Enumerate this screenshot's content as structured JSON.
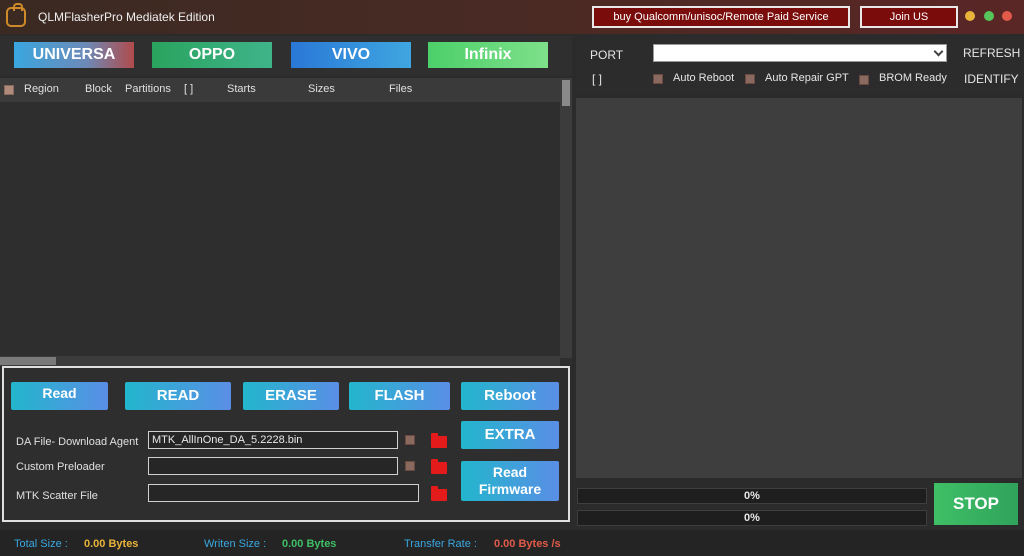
{
  "window": {
    "title": "QLMFlasherPro Mediatek Edition",
    "paid_service_label": "buy Qualcomm/unisoc/Remote Paid Service",
    "join_label": "Join US"
  },
  "brands": {
    "universa": "UNIVERSA",
    "oppo": "OPPO",
    "vivo": "VIVO",
    "infinix": "Infinix"
  },
  "partition_table": {
    "columns": [
      "Region",
      "Block",
      "Partitions",
      "[ ]",
      "Starts",
      "Sizes",
      "Files"
    ]
  },
  "operations": {
    "read_small": "Read",
    "read": "READ",
    "erase": "ERASE",
    "flash": "FLASH",
    "reboot": "Reboot",
    "extra": "EXTRA",
    "read_firmware": "Read Firmware"
  },
  "files": {
    "da_label": "DA File- Download Agent",
    "da_value": "MTK_AllInOne_DA_5.2228.bin",
    "preloader_label": "Custom Preloader",
    "preloader_value": "",
    "scatter_label": "MTK Scatter File",
    "scatter_value": ""
  },
  "device": {
    "port_label": "PORT",
    "port_value": "",
    "refresh": "REFRESH",
    "identify": "IDENTIFY",
    "bracket": "[ ]",
    "auto_reboot": "Auto Reboot",
    "auto_repair_gpt": "Auto Repair GPT",
    "brom_ready": "BROM Ready"
  },
  "progress": {
    "bar1": "0%",
    "bar2": "0%",
    "stop": "STOP"
  },
  "status": {
    "total_label": "Total Size :",
    "total_value": "0.00 Bytes",
    "written_label": "Writen Size :",
    "written_value": "0.00 Bytes",
    "rate_label": "Transfer Rate :",
    "rate_value": "0.00 Bytes /s"
  },
  "colors": {
    "total_value": "#e8b33a",
    "written_value": "#3fbf66",
    "rate_value": "#e25a4a",
    "status_label": "#3aa7e0",
    "paid_button": "#7a0c0c"
  }
}
